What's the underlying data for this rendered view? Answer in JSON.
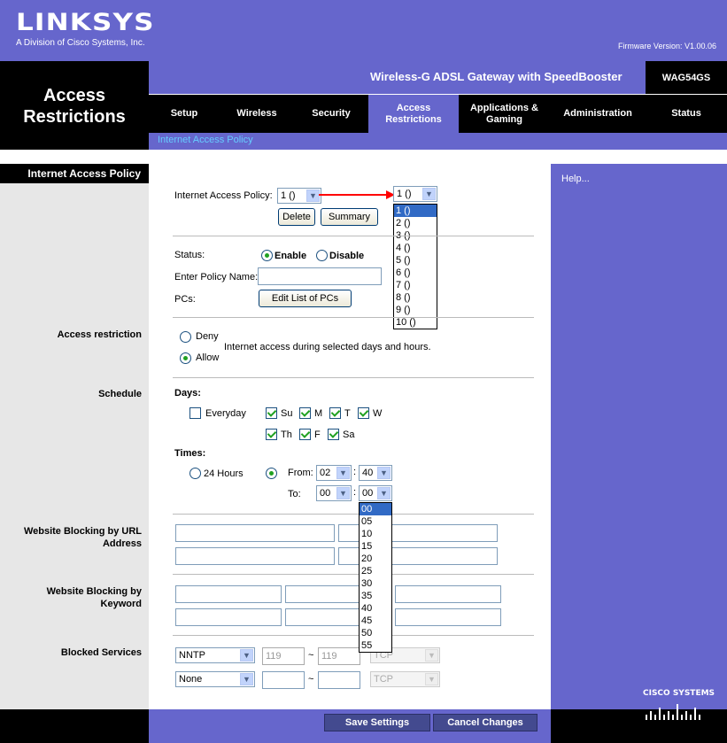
{
  "brand": {
    "logo": "LINKSYS",
    "tagline": "A Division of Cisco Systems, Inc.",
    "firmware": "Firmware Version: V1.00.06",
    "footer_logo": "Cisco Systems"
  },
  "header": {
    "page_title_line1": "Access",
    "page_title_line2": "Restrictions",
    "product": "Wireless-G ADSL Gateway with SpeedBooster",
    "model": "WAG54GS"
  },
  "tabs": [
    {
      "label": "Setup"
    },
    {
      "label": "Wireless"
    },
    {
      "label": "Security"
    },
    {
      "label": "Access Restrictions"
    },
    {
      "label": "Applications & Gaming"
    },
    {
      "label": "Administration"
    },
    {
      "label": "Status"
    }
  ],
  "subtab": "Internet Access Policy",
  "sidebar": {
    "section": "Internet Access Policy",
    "access_restriction": "Access restriction",
    "schedule": "Schedule",
    "url_blocking_line1": "Website Blocking by URL",
    "url_blocking_line2": "Address",
    "keyword_blocking_line1": "Website Blocking by",
    "keyword_blocking_line2": "Keyword",
    "blocked_services": "Blocked Services"
  },
  "help": "Help...",
  "policy": {
    "label": "Internet Access Policy:",
    "value": "1 ()",
    "dropdown_value": "1 ()",
    "options": [
      "1 ()",
      "2 ()",
      "3 ()",
      "4 ()",
      "5 ()",
      "6 ()",
      "7 ()",
      "8 ()",
      "9 ()",
      "10 ()"
    ],
    "delete": "Delete",
    "summary": "Summary"
  },
  "status": {
    "label": "Status:",
    "enable": "Enable",
    "disable": "Disable",
    "selected": "Enable"
  },
  "policy_name": {
    "label": "Enter Policy Name:",
    "value": ""
  },
  "pcs": {
    "label": "PCs:",
    "button": "Edit List of PCs"
  },
  "access": {
    "deny": "Deny",
    "allow": "Allow",
    "note": "Internet access during selected days and hours.",
    "selected": "Allow"
  },
  "days": {
    "label": "Days:",
    "everyday": "Everyday",
    "items": [
      {
        "label": "Su",
        "checked": true
      },
      {
        "label": "M",
        "checked": true
      },
      {
        "label": "T",
        "checked": true
      },
      {
        "label": "W",
        "checked": true
      },
      {
        "label": "Th",
        "checked": true
      },
      {
        "label": "F",
        "checked": true
      },
      {
        "label": "Sa",
        "checked": true
      }
    ],
    "everyday_checked": false
  },
  "times": {
    "label": "Times:",
    "hours24": "24 Hours",
    "from_label": "From:",
    "to_label": "To:",
    "from_hour": "02",
    "from_min": "40",
    "to_hour": "00",
    "to_min": "00",
    "sep": ":",
    "minute_options": [
      "00",
      "05",
      "10",
      "15",
      "20",
      "25",
      "30",
      "35",
      "40",
      "45",
      "50",
      "55"
    ]
  },
  "services": {
    "rows": [
      {
        "service": "NNTP",
        "port_from": "119",
        "port_to": "119",
        "protocol": "TCP"
      },
      {
        "service": "None",
        "port_from": "",
        "port_to": "",
        "protocol": "TCP"
      }
    ],
    "tilde": "~"
  },
  "footer": {
    "save": "Save Settings",
    "cancel": "Cancel Changes"
  },
  "colors": {
    "purple": "#6666cc",
    "black": "#000000",
    "gray": "#e7e7e7",
    "accent": "#66ccff",
    "annotation_arrow": "#ff0000"
  }
}
